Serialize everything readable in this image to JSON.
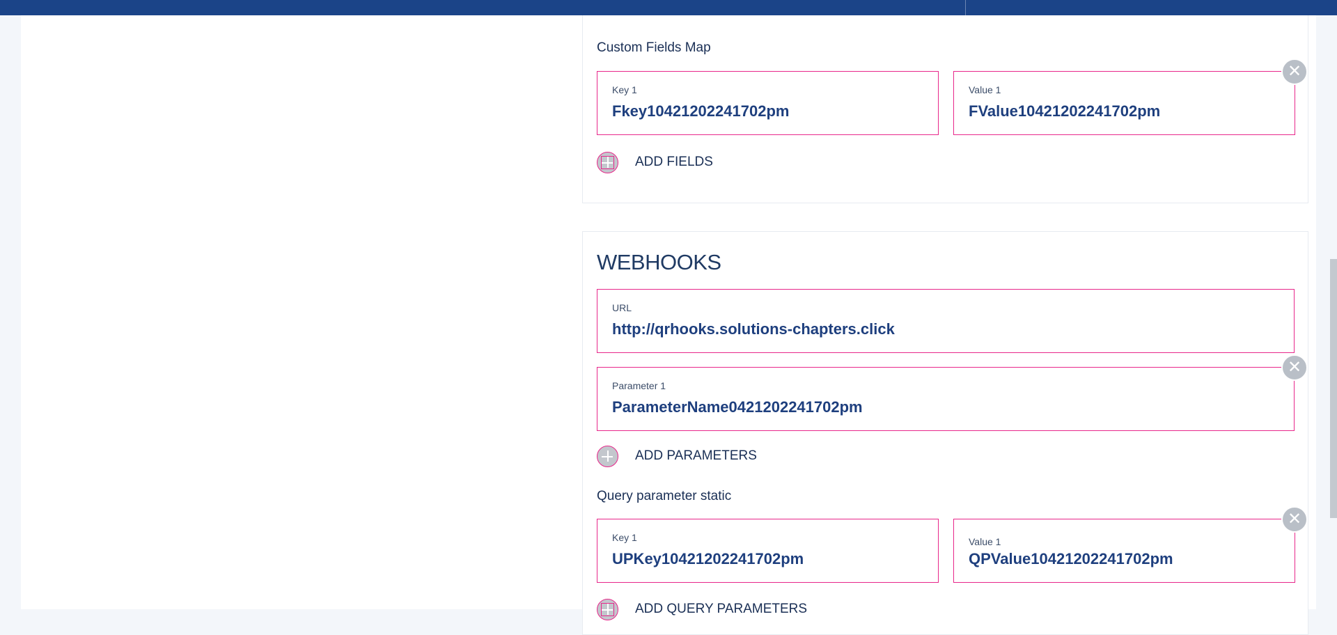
{
  "custom_fields": {
    "label": "Custom Fields Map",
    "rows": [
      {
        "key_label": "Key 1",
        "key_value": "Fkey10421202241702pm",
        "value_label": "Value 1",
        "value_value": "FValue10421202241702pm"
      }
    ],
    "add_label": "ADD FIELDS"
  },
  "webhooks": {
    "title": "WEBHOOKS",
    "url": {
      "label": "URL",
      "value": "http://qrhooks.solutions-chapters.click"
    },
    "parameters": [
      {
        "label": "Parameter 1",
        "value": "ParameterName0421202241702pm"
      }
    ],
    "add_parameters_label": "ADD PARAMETERS",
    "query_static": {
      "label": "Query parameter static",
      "rows": [
        {
          "key_label": "Key 1",
          "key_value": "UPKey10421202241702pm",
          "value_label": "Value 1",
          "value_value": "QPValue10421202241702pm"
        }
      ],
      "add_label": "ADD QUERY PARAMETERS"
    }
  },
  "icons": {
    "remove": "close-icon",
    "add": "plus-icon"
  },
  "colors": {
    "topbar": "#1b4488",
    "field_border": "#e8268a",
    "text": "#1e3f7e"
  }
}
